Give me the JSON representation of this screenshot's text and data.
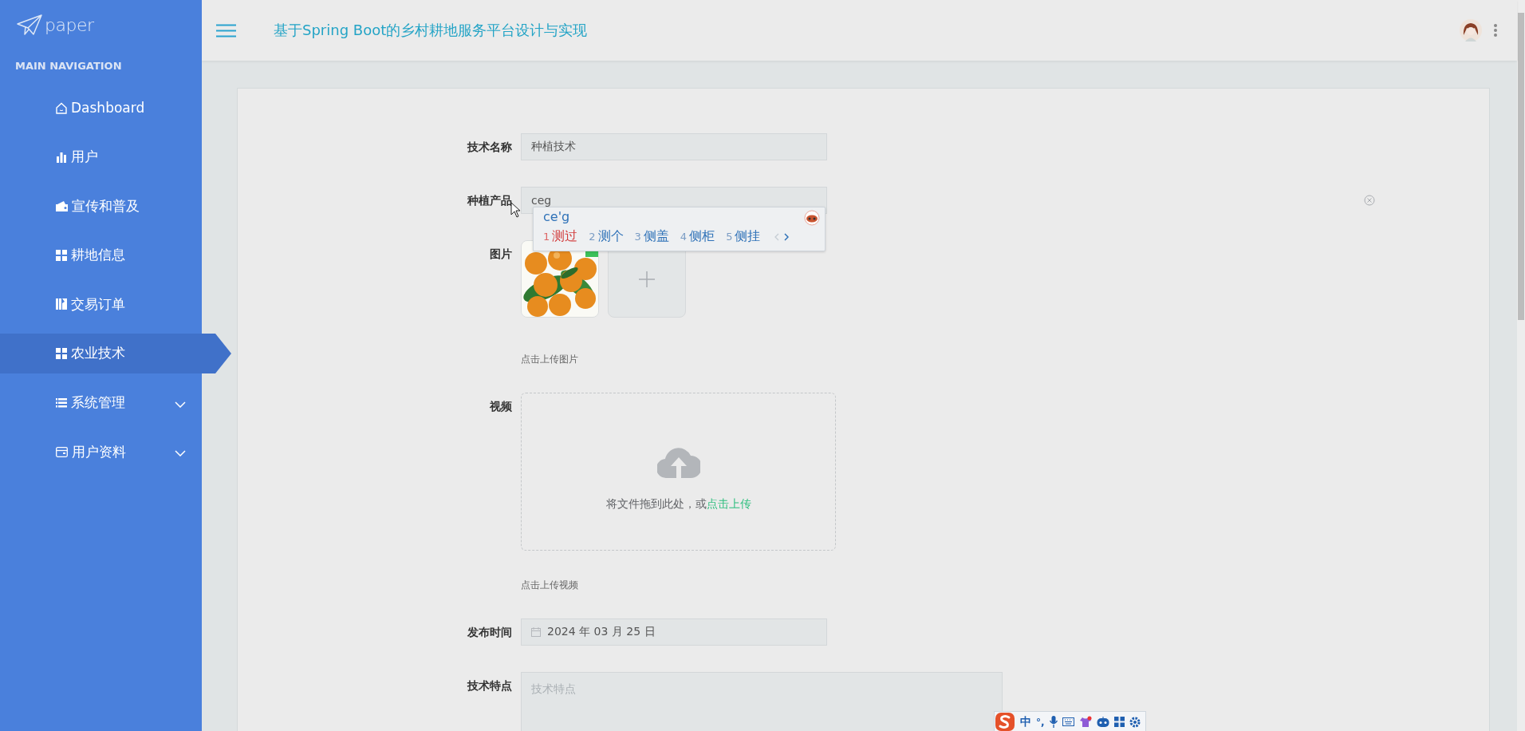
{
  "sidebar": {
    "logo": "paper",
    "section": "MAIN NAVIGATION",
    "items": [
      {
        "label": "Dashboard",
        "kind": "link",
        "selected": false
      },
      {
        "label": "用户",
        "kind": "link",
        "selected": false
      },
      {
        "label": "宣传和普及",
        "kind": "link",
        "selected": false
      },
      {
        "label": "耕地信息",
        "kind": "link",
        "selected": false
      },
      {
        "label": "交易订单",
        "kind": "link",
        "selected": false
      },
      {
        "label": "农业技术",
        "kind": "link",
        "selected": true
      },
      {
        "label": "系统管理",
        "kind": "submenu",
        "selected": false,
        "expanded": false
      },
      {
        "label": "用户资料",
        "kind": "submenu",
        "selected": false,
        "expanded": false
      }
    ]
  },
  "header": {
    "title": "基于Spring Boot的乡村耕地服务平台设计与实现"
  },
  "form": {
    "fields": [
      {
        "kind": "text",
        "label": "技术名称",
        "value": "种植技术"
      },
      {
        "kind": "text",
        "label": "种植产品",
        "value": "ceg",
        "clearable": true
      },
      {
        "kind": "image-upload",
        "label": "图片",
        "hint": "点击上传图片"
      },
      {
        "kind": "video-upload",
        "label": "视频",
        "drop_text": "将文件拖到此处，或",
        "drop_link": "点击上传",
        "hint": "点击上传视频"
      },
      {
        "kind": "date",
        "label": "发布时间",
        "value": "2024 年 03 月 25 日"
      },
      {
        "kind": "textarea",
        "label": "技术特点",
        "placeholder": "技术特点"
      }
    ]
  },
  "ime": {
    "composition": "ce'g",
    "candidates": [
      {
        "index": "1",
        "text": "测过",
        "selected": true
      },
      {
        "index": "2",
        "text": "测个",
        "selected": false
      },
      {
        "index": "3",
        "text": "侧盖",
        "selected": false
      },
      {
        "index": "4",
        "text": "侧柜",
        "selected": false
      },
      {
        "index": "5",
        "text": "侧挂",
        "selected": false
      }
    ]
  },
  "ime_toolbar": {
    "mode": "中",
    "punctuation": "°,"
  }
}
